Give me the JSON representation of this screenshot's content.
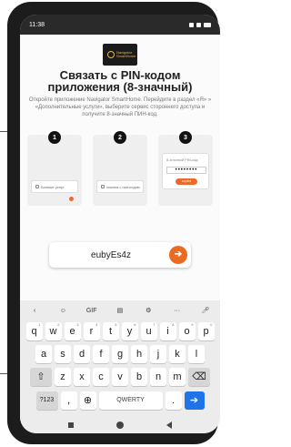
{
  "status": {
    "time": "11:38"
  },
  "logo": {
    "text": "Navigator SmartHome"
  },
  "page": {
    "title": "Связать с PIN-кодом приложения (8-значный)",
    "description": "Откройте приложение Navigator SmartHome. Перейдите в раздел «Я» » «Дополнительные услуги», выберите сервис стороннего доступа и получите 8-значный ПИН-код."
  },
  "steps": [
    {
      "number": "1",
      "label": "Больше услуг"
    },
    {
      "number": "2",
      "label": "ссылка с пин-кодом"
    },
    {
      "number": "3",
      "pin_label": "8-значный PIN-код",
      "pin_value": "••••••••",
      "button_label": "copied"
    }
  ],
  "code_input": {
    "value": "eubyEs4z",
    "submit_icon": "arrow-right-icon"
  },
  "keyboard": {
    "toolbar": {
      "back": "‹",
      "gif": "GIF",
      "more": "···"
    },
    "row1": [
      {
        "key": "q",
        "alt": "1"
      },
      {
        "key": "w",
        "alt": "2"
      },
      {
        "key": "e",
        "alt": "3"
      },
      {
        "key": "r",
        "alt": "4"
      },
      {
        "key": "t",
        "alt": "5"
      },
      {
        "key": "y",
        "alt": "6"
      },
      {
        "key": "u",
        "alt": "7"
      },
      {
        "key": "i",
        "alt": "8"
      },
      {
        "key": "o",
        "alt": "9"
      },
      {
        "key": "p",
        "alt": "0"
      }
    ],
    "row2": [
      "a",
      "s",
      "d",
      "f",
      "g",
      "h",
      "j",
      "k",
      "l"
    ],
    "row3": [
      "z",
      "x",
      "c",
      "v",
      "b",
      "n",
      "m"
    ],
    "row4": {
      "symbols": "?123",
      "comma": ",",
      "space": "QWERTY",
      "period": "."
    }
  },
  "colors": {
    "accent": "#ec6b22",
    "enter": "#1e73e8"
  }
}
